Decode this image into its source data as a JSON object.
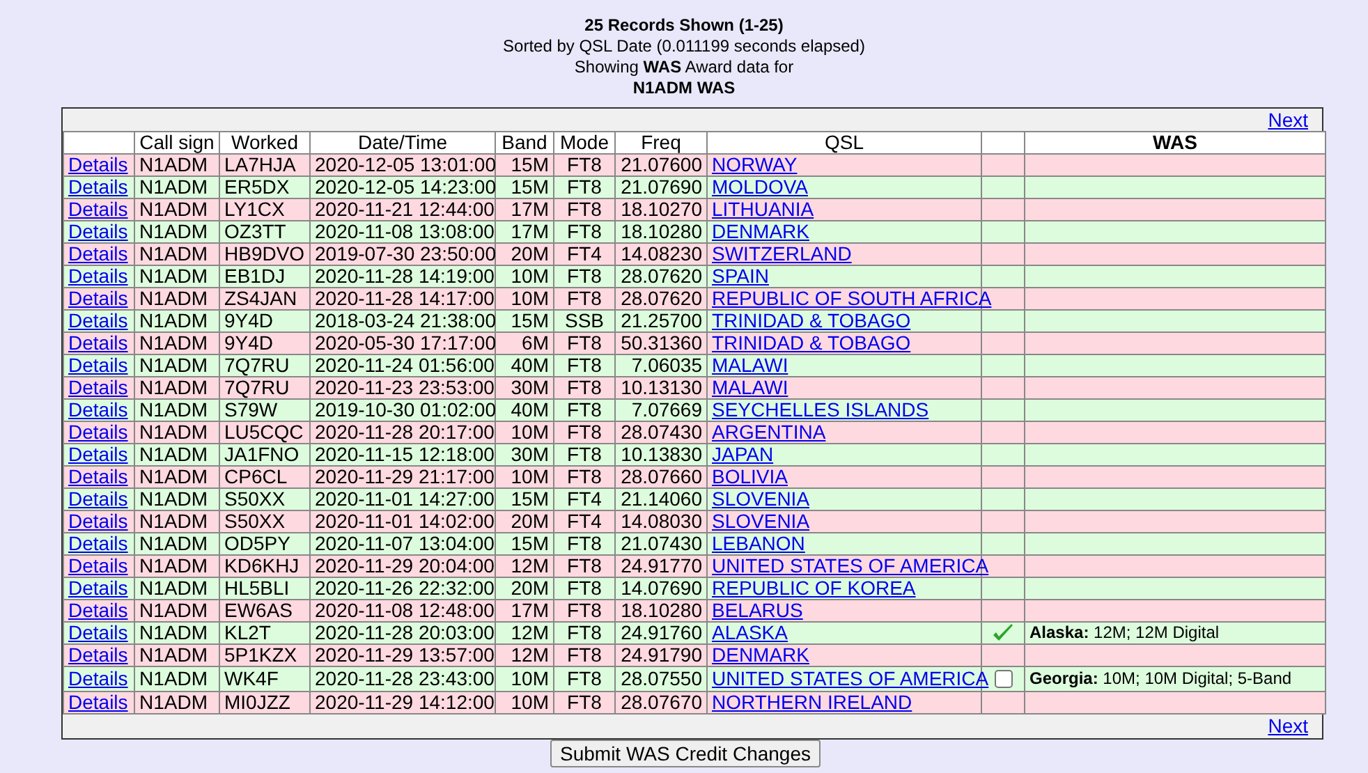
{
  "header": {
    "title": "25 Records Shown (1-25)",
    "sorted": "Sorted by QSL Date (0.011199 seconds elapsed)",
    "showing": "Showing **WAS** Award data for",
    "subject": "N1ADM WAS"
  },
  "pager_top": "Next",
  "columns": [
    "Call sign",
    "Worked",
    "Date/Time",
    "Band",
    "Mode",
    "Freq",
    "QSL",
    "WAS"
  ],
  "rows": [
    {
      "details": "Details",
      "call": "N1ADM",
      "worked": "LA7HJA",
      "datetime": "2020-12-05 13:01:00",
      "band": "15M",
      "mode": "FT8",
      "freq": "21.07600",
      "qsl": "NORWAY"
    },
    {
      "details": "Details",
      "call": "N1ADM",
      "worked": "ER5DX",
      "datetime": "2020-12-05 14:23:00",
      "band": "15M",
      "mode": "FT8",
      "freq": "21.07690",
      "qsl": "MOLDOVA"
    },
    {
      "details": "Details",
      "call": "N1ADM",
      "worked": "LY1CX",
      "datetime": "2020-11-21 12:44:00",
      "band": "17M",
      "mode": "FT8",
      "freq": "18.10270",
      "qsl": "LITHUANIA"
    },
    {
      "details": "Details",
      "call": "N1ADM",
      "worked": "OZ3TT",
      "datetime": "2020-11-08 13:08:00",
      "band": "17M",
      "mode": "FT8",
      "freq": "18.10280",
      "qsl": "DENMARK"
    },
    {
      "details": "Details",
      "call": "N1ADM",
      "worked": "HB9DVO",
      "datetime": "2019-07-30 23:50:00",
      "band": "20M",
      "mode": "FT4",
      "freq": "14.08230",
      "qsl": "SWITZERLAND"
    },
    {
      "details": "Details",
      "call": "N1ADM",
      "worked": "EB1DJ",
      "datetime": "2020-11-28 14:19:00",
      "band": "10M",
      "mode": "FT8",
      "freq": "28.07620",
      "qsl": "SPAIN"
    },
    {
      "details": "Details",
      "call": "N1ADM",
      "worked": "ZS4JAN",
      "datetime": "2020-11-28 14:17:00",
      "band": "10M",
      "mode": "FT8",
      "freq": "28.07620",
      "qsl": "REPUBLIC OF SOUTH AFRICA"
    },
    {
      "details": "Details",
      "call": "N1ADM",
      "worked": "9Y4D",
      "datetime": "2018-03-24 21:38:00",
      "band": "15M",
      "mode": "SSB",
      "freq": "21.25700",
      "qsl": "TRINIDAD & TOBAGO"
    },
    {
      "details": "Details",
      "call": "N1ADM",
      "worked": "9Y4D",
      "datetime": "2020-05-30 17:17:00",
      "band": "6M",
      "mode": "FT8",
      "freq": "50.31360",
      "qsl": "TRINIDAD & TOBAGO"
    },
    {
      "details": "Details",
      "call": "N1ADM",
      "worked": "7Q7RU",
      "datetime": "2020-11-24 01:56:00",
      "band": "40M",
      "mode": "FT8",
      "freq": "7.06035",
      "qsl": "MALAWI"
    },
    {
      "details": "Details",
      "call": "N1ADM",
      "worked": "7Q7RU",
      "datetime": "2020-11-23 23:53:00",
      "band": "30M",
      "mode": "FT8",
      "freq": "10.13130",
      "qsl": "MALAWI"
    },
    {
      "details": "Details",
      "call": "N1ADM",
      "worked": "S79W",
      "datetime": "2019-10-30 01:02:00",
      "band": "40M",
      "mode": "FT8",
      "freq": "7.07669",
      "qsl": "SEYCHELLES ISLANDS"
    },
    {
      "details": "Details",
      "call": "N1ADM",
      "worked": "LU5CQC",
      "datetime": "2020-11-28 20:17:00",
      "band": "10M",
      "mode": "FT8",
      "freq": "28.07430",
      "qsl": "ARGENTINA"
    },
    {
      "details": "Details",
      "call": "N1ADM",
      "worked": "JA1FNO",
      "datetime": "2020-11-15 12:18:00",
      "band": "30M",
      "mode": "FT8",
      "freq": "10.13830",
      "qsl": "JAPAN"
    },
    {
      "details": "Details",
      "call": "N1ADM",
      "worked": "CP6CL",
      "datetime": "2020-11-29 21:17:00",
      "band": "10M",
      "mode": "FT8",
      "freq": "28.07660",
      "qsl": "BOLIVIA"
    },
    {
      "details": "Details",
      "call": "N1ADM",
      "worked": "S50XX",
      "datetime": "2020-11-01 14:27:00",
      "band": "15M",
      "mode": "FT4",
      "freq": "21.14060",
      "qsl": "SLOVENIA"
    },
    {
      "details": "Details",
      "call": "N1ADM",
      "worked": "S50XX",
      "datetime": "2020-11-01 14:02:00",
      "band": "20M",
      "mode": "FT4",
      "freq": "14.08030",
      "qsl": "SLOVENIA"
    },
    {
      "details": "Details",
      "call": "N1ADM",
      "worked": "OD5PY",
      "datetime": "2020-11-07 13:04:00",
      "band": "15M",
      "mode": "FT8",
      "freq": "21.07430",
      "qsl": "LEBANON"
    },
    {
      "details": "Details",
      "call": "N1ADM",
      "worked": "KD6KHJ",
      "datetime": "2020-11-29 20:04:00",
      "band": "12M",
      "mode": "FT8",
      "freq": "24.91770",
      "qsl": "UNITED STATES OF AMERICA"
    },
    {
      "details": "Details",
      "call": "N1ADM",
      "worked": "HL5BLI",
      "datetime": "2020-11-26 22:32:00",
      "band": "20M",
      "mode": "FT8",
      "freq": "14.07690",
      "qsl": "REPUBLIC OF KOREA"
    },
    {
      "details": "Details",
      "call": "N1ADM",
      "worked": "EW6AS",
      "datetime": "2020-11-08 12:48:00",
      "band": "17M",
      "mode": "FT8",
      "freq": "18.10280",
      "qsl": "BELARUS"
    },
    {
      "details": "Details",
      "call": "N1ADM",
      "worked": "KL2T",
      "datetime": "2020-11-28 20:03:00",
      "band": "12M",
      "mode": "FT8",
      "freq": "24.91760",
      "qsl": "ALASKA",
      "credit": {
        "kind": "granted"
      },
      "was": "**Alaska:** 12M; 12M Digital"
    },
    {
      "details": "Details",
      "call": "N1ADM",
      "worked": "5P1KZX",
      "datetime": "2020-11-29 13:57:00",
      "band": "12M",
      "mode": "FT8",
      "freq": "24.91790",
      "qsl": "DENMARK"
    },
    {
      "details": "Details",
      "call": "N1ADM",
      "worked": "WK4F",
      "datetime": "2020-11-28 23:43:00",
      "band": "10M",
      "mode": "FT8",
      "freq": "28.07550",
      "qsl": "UNITED STATES OF AMERICA",
      "credit": {
        "kind": "checkbox",
        "checked": false
      },
      "was": "**Georgia:** 10M; 10M Digital; 5-Band"
    },
    {
      "details": "Details",
      "call": "N1ADM",
      "worked": "MI0JZZ",
      "datetime": "2020-11-29 14:12:00",
      "band": "10M",
      "mode": "FT8",
      "freq": "28.07670",
      "qsl": "NORTHERN IRELAND"
    }
  ],
  "pager_bottom": "Next",
  "submit": "Submit WAS Credit Changes"
}
